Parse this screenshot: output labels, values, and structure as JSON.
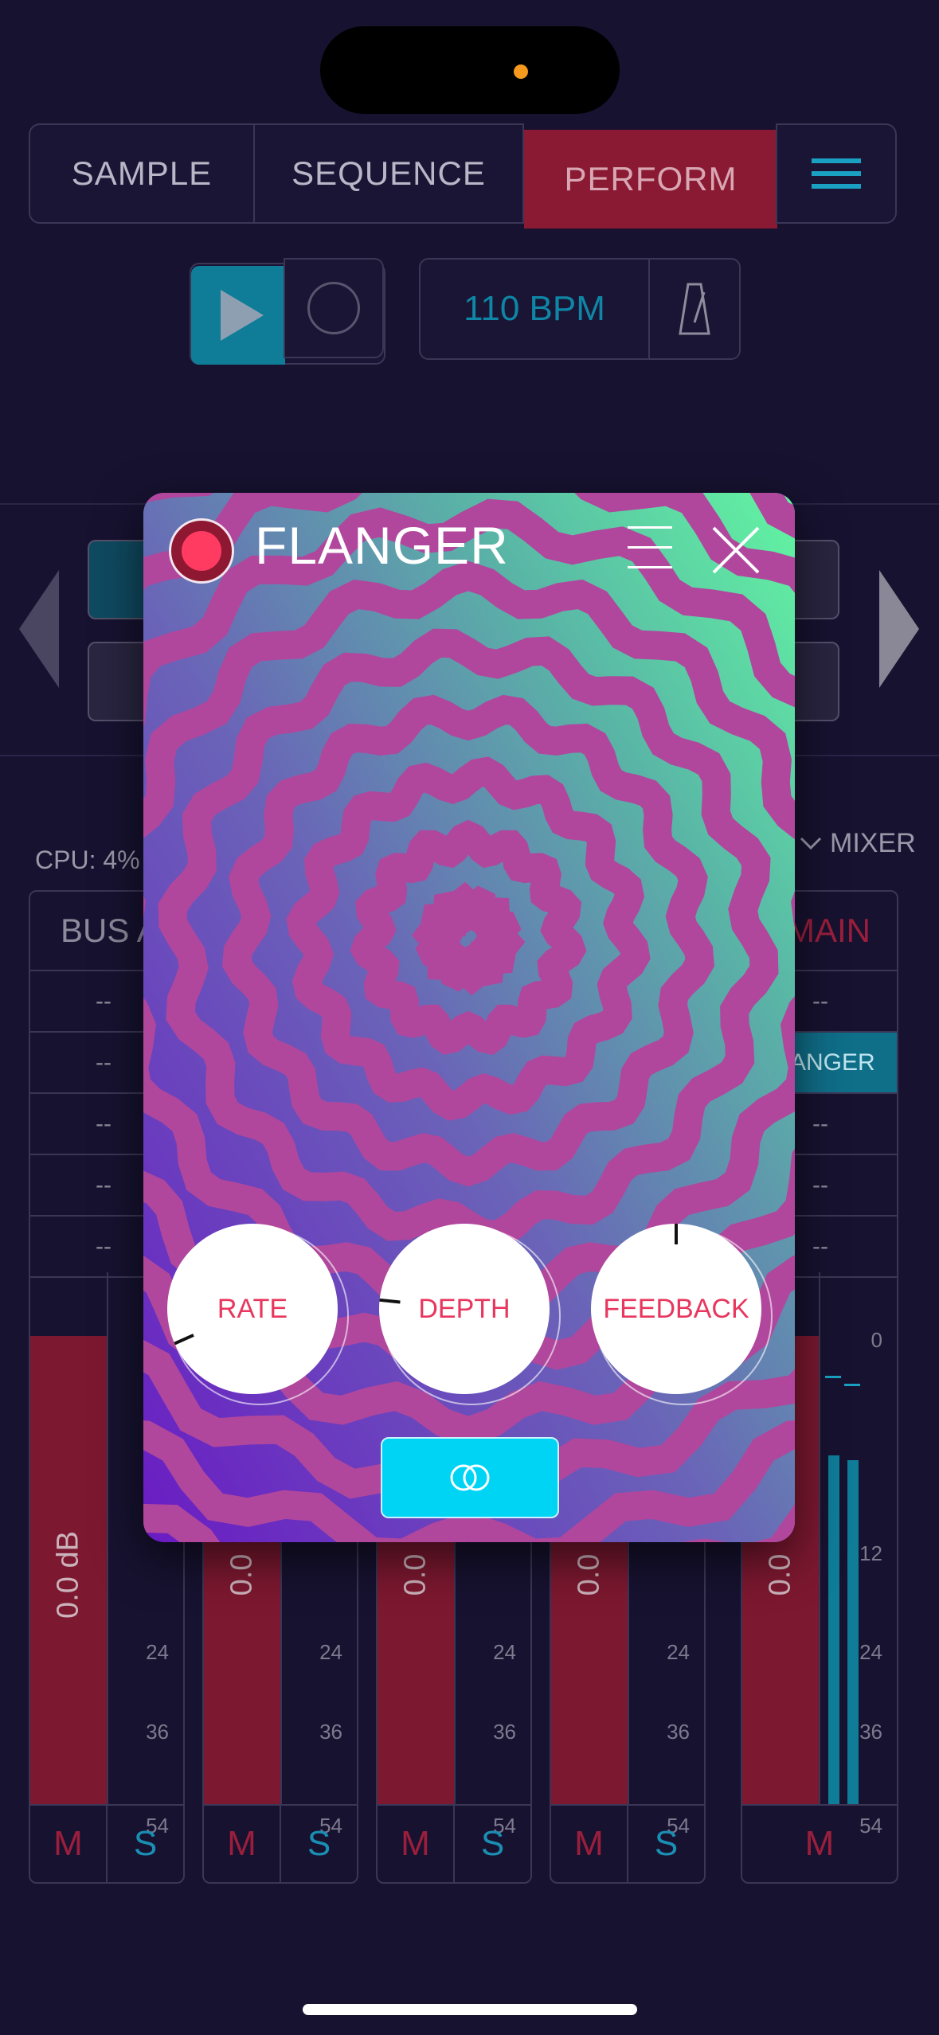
{
  "header": {
    "tabs": [
      {
        "label": "SAMPLE"
      },
      {
        "label": "SEQUENCE"
      },
      {
        "label": "PERFORM"
      }
    ],
    "menu_icon": "hamburger-icon"
  },
  "transport": {
    "play_icon": "play-icon",
    "record_icon": "record-icon",
    "bpm": "110 BPM",
    "metronome_icon": "metronome-icon"
  },
  "mixer": {
    "cpu": "CPU: 4%",
    "mixer_label": "MIXER",
    "strips": [
      {
        "title": "BUS A",
        "slots": [
          "--",
          "--",
          "--",
          "--",
          "--"
        ],
        "level": "0.0 dB",
        "scale": [
          "24",
          "36",
          "54"
        ],
        "mute": "M",
        "solo": "S"
      },
      {
        "title": "",
        "slots": [],
        "level": "0.0",
        "scale": [
          "24",
          "36",
          "54"
        ],
        "mute": "M",
        "solo": "S"
      },
      {
        "title": "",
        "slots": [],
        "level": "0.0",
        "scale": [
          "24",
          "36",
          "54"
        ],
        "mute": "M",
        "solo": "S"
      },
      {
        "title": "",
        "slots": [],
        "level": "0.0",
        "scale": [
          "24",
          "36",
          "54"
        ],
        "mute": "M",
        "solo": "S"
      },
      {
        "title": "MAIN",
        "slots": [
          "--",
          "ANGER",
          "--",
          "--",
          "--"
        ],
        "level": "0.0",
        "scale": [
          "0",
          "12",
          "24",
          "36",
          "54"
        ],
        "mute": "M"
      }
    ]
  },
  "modal": {
    "title": "FLANGER",
    "knobs": [
      {
        "label": "RATE",
        "value": 0.12
      },
      {
        "label": "DEPTH",
        "value": 0.22
      },
      {
        "label": "FEEDBACK",
        "value": 0.5
      }
    ],
    "link_icon": "link-rings-icon"
  },
  "colors": {
    "background": "#171230",
    "accent_red": "#8a1a33",
    "accent_teal": "#0f7c98",
    "knob_text": "#e8365e",
    "link_button": "#00d4f5"
  }
}
